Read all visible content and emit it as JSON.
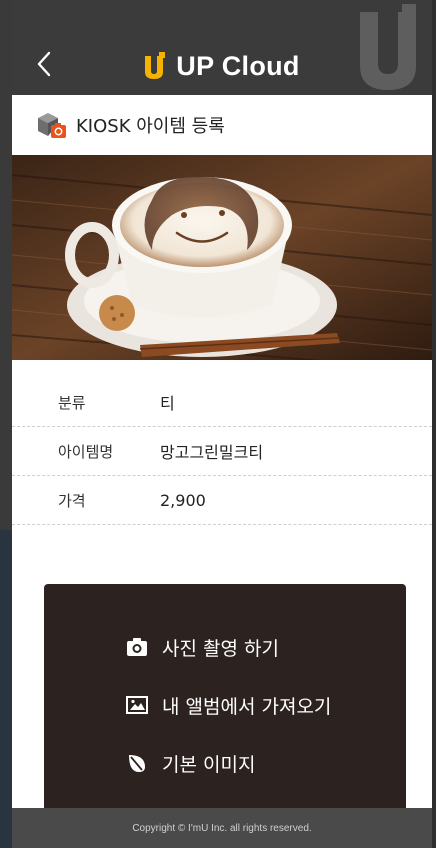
{
  "header": {
    "title": "UP Cloud",
    "back_icon": "chevron-left-icon",
    "logo_icon": "up-logo-icon",
    "bg_color": "#3b3b3b",
    "accent_color": "#f5b400"
  },
  "page": {
    "title": "KIOSK 아이템 등록",
    "title_icon": "kiosk-box-icon"
  },
  "item": {
    "image": "latte-art-photo",
    "fields": [
      {
        "label": "분류",
        "value": "티"
      },
      {
        "label": "아이템명",
        "value": "망고그린밀크티"
      },
      {
        "label": "가격",
        "value": "2,900"
      }
    ]
  },
  "actions": [
    {
      "label": "사진 촬영 하기",
      "icon": "camera-icon"
    },
    {
      "label": "내 앨범에서 가져오기",
      "icon": "image-icon"
    },
    {
      "label": "기본 이미지",
      "icon": "leaf-icon"
    }
  ],
  "footer": {
    "copyright": "Copyright © I'mU Inc. all rights reserved."
  }
}
